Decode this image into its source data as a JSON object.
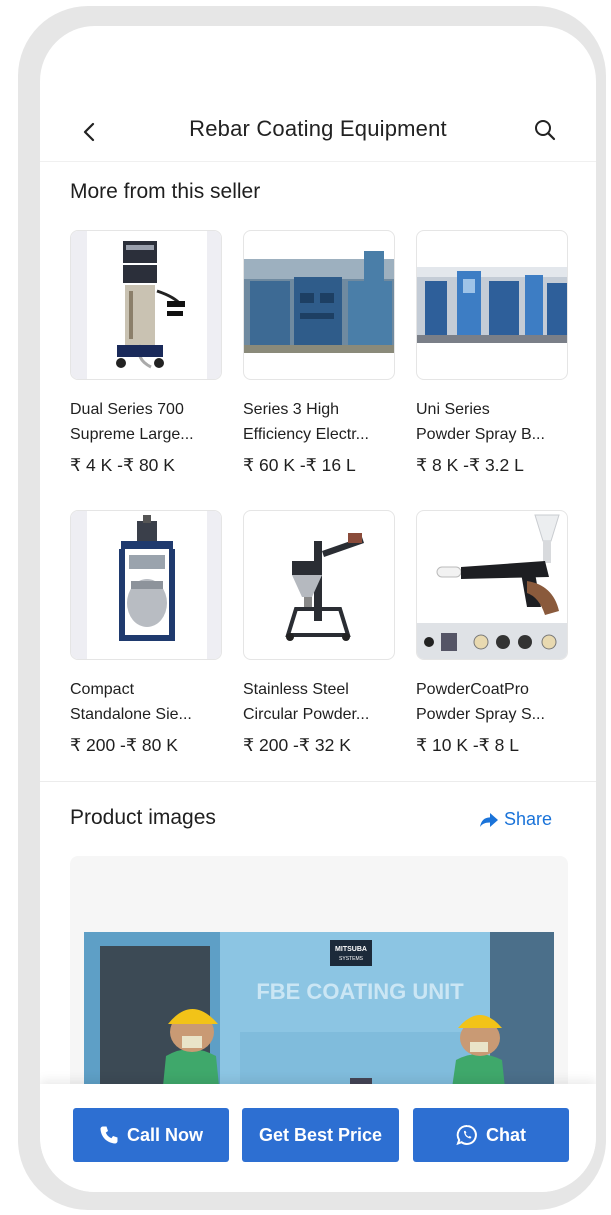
{
  "header": {
    "title": "Rebar Coating Equipment"
  },
  "more_from_seller": {
    "title": "More from this seller",
    "products": [
      {
        "name": "Dual Series 700 Supreme Large...",
        "name_line1": "Dual Series 700",
        "name_line2": "Supreme Large...",
        "price": "₹ 4 K -₹ 80 K"
      },
      {
        "name": "Series 3 High Efficiency Electr...",
        "name_line1": "Series 3 High",
        "name_line2": "Efficiency Electr...",
        "price": "₹ 60 K -₹ 16 L"
      },
      {
        "name": "Uni Series Powder Spray B...",
        "name_line1": "Uni Series",
        "name_line2": "Powder Spray B...",
        "price": "₹ 8 K -₹ 3.2 L"
      },
      {
        "name": "Compact Standalone Sie...",
        "name_line1": "Compact",
        "name_line2": "Standalone Sie...",
        "price": "₹ 200 -₹ 80 K"
      },
      {
        "name": "Stainless Steel Circular Powder...",
        "name_line1": "Stainless Steel",
        "name_line2": "Circular Powder...",
        "price": "₹ 200 -₹ 32 K"
      },
      {
        "name": "PowderCoatPro Powder Spray S...",
        "name_line1": "PowderCoatPro",
        "name_line2": "Powder Spray S...",
        "price": "₹ 10 K -₹ 8 L"
      }
    ]
  },
  "product_images": {
    "title": "Product images",
    "share_label": "Share",
    "image_text": {
      "brand": "MITSUBA",
      "brand_sub": "SYSTEMS",
      "unit": "FBE COATING UNIT"
    }
  },
  "actions": {
    "call_label": "Call Now",
    "price_label": "Get Best Price",
    "chat_label": "Chat"
  },
  "colors": {
    "accent": "#2d6fd2",
    "link": "#1a73d9"
  }
}
